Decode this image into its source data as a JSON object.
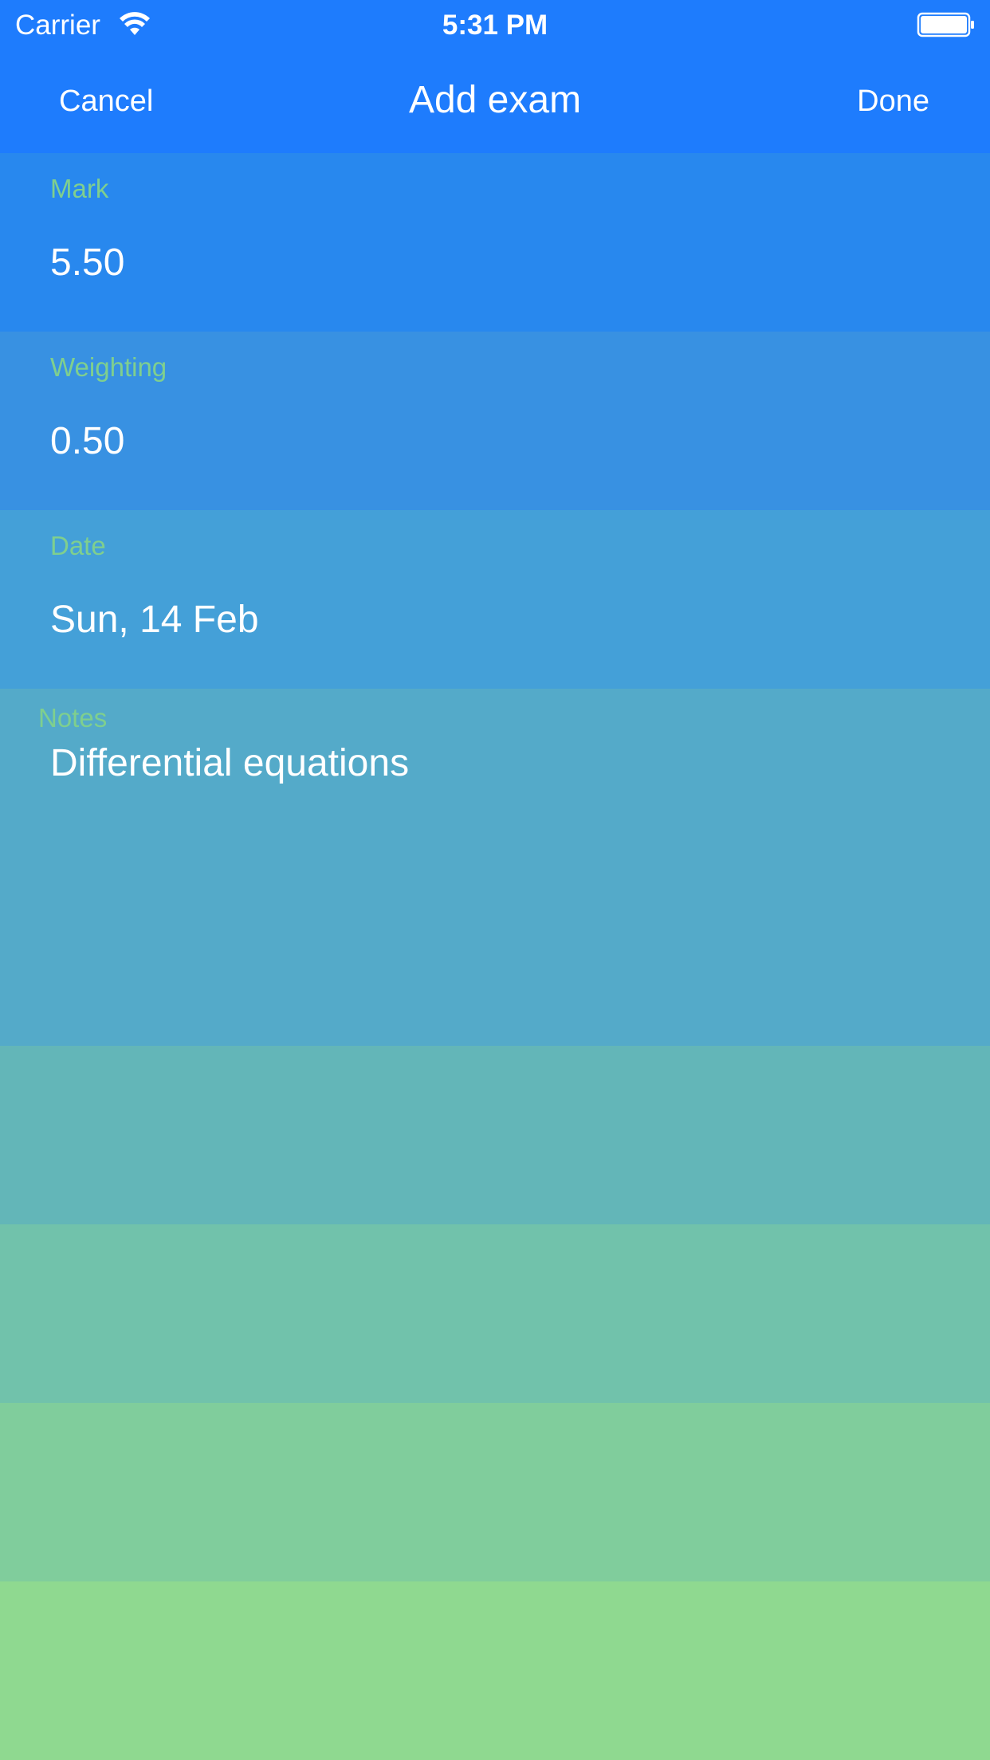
{
  "status_bar": {
    "carrier": "Carrier",
    "time": "5:31 PM",
    "wifi_icon": "wifi-icon",
    "battery_icon": "battery-icon"
  },
  "nav": {
    "cancel_label": "Cancel",
    "title": "Add exam",
    "done_label": "Done"
  },
  "form": {
    "mark": {
      "label": "Mark",
      "value": "5.50"
    },
    "weighting": {
      "label": "Weighting",
      "value": "0.50"
    },
    "date": {
      "label": "Date",
      "value": "Sun, 14 Feb"
    },
    "notes": {
      "label": "Notes",
      "value": "Differential equations"
    }
  },
  "colors": {
    "nav_background": "#1e7cfd",
    "label_green": "#7fcf8e",
    "row_gradient": [
      "#2888ee",
      "#3891e2",
      "#44a0d8",
      "#54aac9",
      "#63b6b8",
      "#71c2ab",
      "#80cd9c",
      "#8fd990"
    ]
  }
}
